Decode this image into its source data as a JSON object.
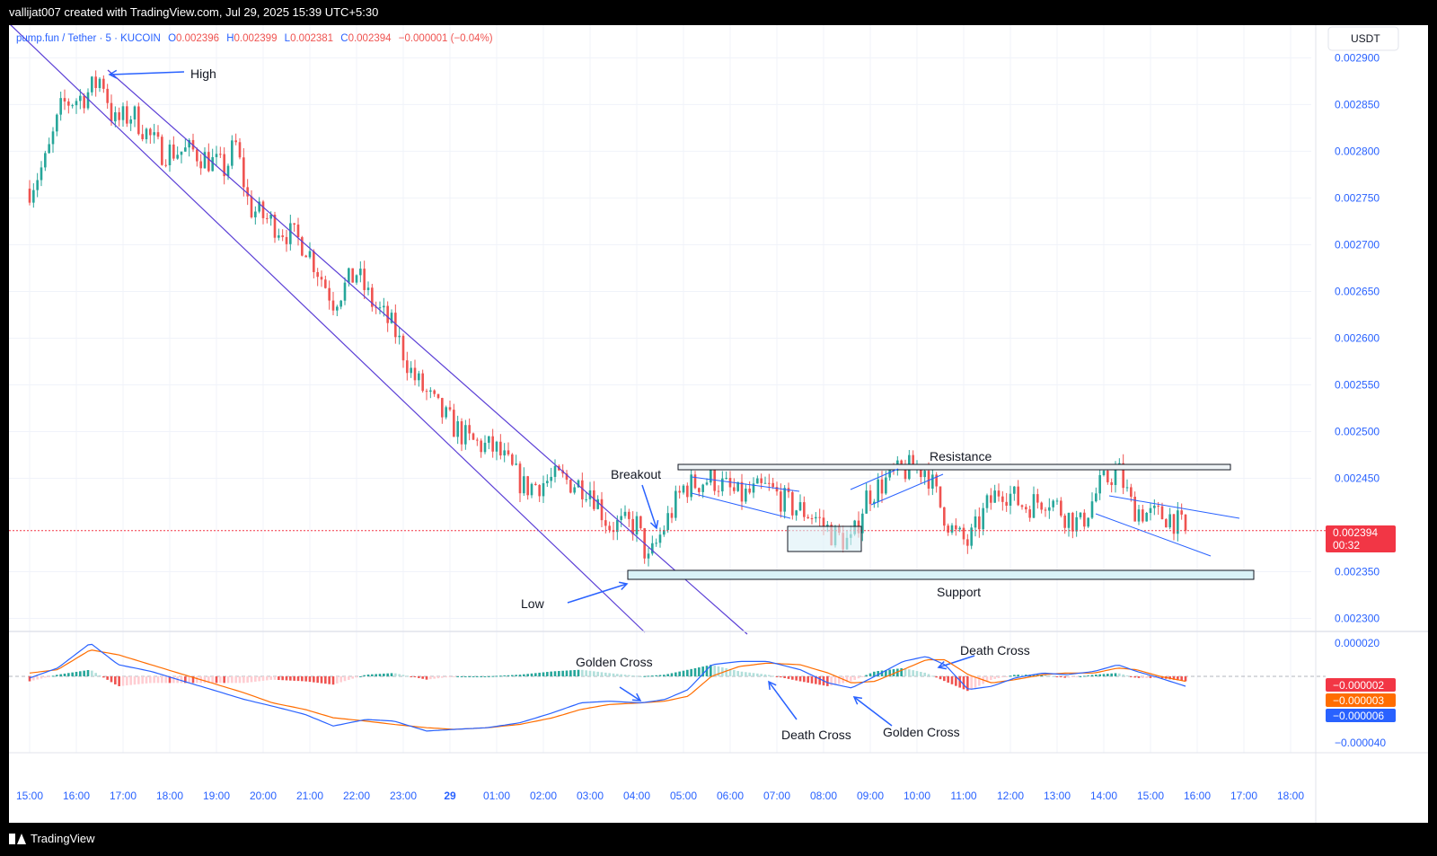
{
  "header": {
    "creator_line": "vallijat007 created with TradingView.com, Jul 29, 2025 15:39 UTC+5:30"
  },
  "footer": {
    "brand": "TradingView"
  },
  "legend": {
    "symbol": "pump.fun / Tether · 5 · KUCOIN",
    "o_label": "O",
    "o_value": "0.002396",
    "h_label": "H",
    "h_value": "0.002399",
    "l_label": "L",
    "l_value": "0.002381",
    "c_label": "C",
    "c_value": "0.002394",
    "change": "−0.000001 (−0.04%)"
  },
  "currency": "USDT",
  "colors": {
    "up": "#26a69a",
    "down": "#ef5350",
    "drawing": "#5b3fd6",
    "trend": "#2962ff",
    "macd_line": "#2962ff",
    "signal_line": "#ff6d00",
    "hist_up": "#26a69a",
    "hist_down": "#ef5350",
    "price_tag": "#f23645",
    "support_fill": "#d9f2f7",
    "label_blue": "#2962ff"
  },
  "price_tag": {
    "value": "0.002394",
    "countdown": "00:32"
  },
  "macd_tags": [
    "−0.000002",
    "−0.000003",
    "−0.000006"
  ],
  "annotations": {
    "high": "High",
    "low": "Low",
    "breakout": "Breakout",
    "resistance": "Resistance",
    "support": "Support",
    "golden_cross_1": "Golden Cross",
    "death_cross_1": "Death Cross",
    "golden_cross_2": "Golden Cross",
    "death_cross_2": "Death Cross"
  },
  "chart_data": {
    "type": "candlestick",
    "y_ticks": [
      "0.002900",
      "0.002850",
      "0.002800",
      "0.002750",
      "0.002700",
      "0.002650",
      "0.002600",
      "0.002550",
      "0.002500",
      "0.002450",
      "0.002350",
      "0.002300"
    ],
    "ylim": [
      0.002288,
      0.002935
    ],
    "x_ticks": [
      "15:00",
      "16:00",
      "17:00",
      "18:00",
      "19:00",
      "20:00",
      "21:00",
      "22:00",
      "23:00",
      "29",
      "01:00",
      "02:00",
      "03:00",
      "04:00",
      "05:00",
      "06:00",
      "07:00",
      "08:00",
      "09:00",
      "10:00",
      "11:00",
      "12:00",
      "13:00",
      "14:00",
      "15:00",
      "16:00",
      "17:00",
      "18:00"
    ],
    "close_path": [
      [
        0.0,
        0.00276
      ],
      [
        0.35,
        0.00279
      ],
      [
        0.7,
        0.00285
      ],
      [
        1.2,
        0.00286
      ],
      [
        1.55,
        0.00288
      ],
      [
        1.8,
        0.00283
      ],
      [
        2.2,
        0.00284
      ],
      [
        2.8,
        0.0028
      ],
      [
        3.5,
        0.0028
      ],
      [
        4.2,
        0.00278
      ],
      [
        4.4,
        0.00281
      ],
      [
        4.7,
        0.00274
      ],
      [
        5.3,
        0.00272
      ],
      [
        5.9,
        0.0027
      ],
      [
        6.5,
        0.00264
      ],
      [
        7.0,
        0.00267
      ],
      [
        7.3,
        0.00264
      ],
      [
        7.8,
        0.00261
      ],
      [
        8.2,
        0.00256
      ],
      [
        8.8,
        0.00252
      ],
      [
        9.4,
        0.00249
      ],
      [
        10.0,
        0.00248
      ],
      [
        10.6,
        0.00244
      ],
      [
        11.3,
        0.00245
      ],
      [
        12.0,
        0.00244
      ],
      [
        12.4,
        0.0024
      ],
      [
        13.0,
        0.0024
      ],
      [
        13.25,
        0.00236
      ],
      [
        13.6,
        0.0024
      ],
      [
        14.0,
        0.00244
      ],
      [
        14.6,
        0.00245
      ],
      [
        15.2,
        0.00243
      ],
      [
        15.8,
        0.00244
      ],
      [
        16.3,
        0.00242
      ],
      [
        16.8,
        0.00241
      ],
      [
        17.2,
        0.00239
      ],
      [
        17.6,
        0.00238
      ],
      [
        17.9,
        0.00243
      ],
      [
        18.4,
        0.00245
      ],
      [
        18.8,
        0.00246
      ],
      [
        19.2,
        0.00246
      ],
      [
        19.5,
        0.00242
      ],
      [
        19.8,
        0.00239
      ],
      [
        20.1,
        0.00238
      ],
      [
        20.5,
        0.00242
      ],
      [
        20.8,
        0.00244
      ],
      [
        21.3,
        0.00242
      ],
      [
        21.8,
        0.00243
      ],
      [
        22.2,
        0.00241
      ],
      [
        22.5,
        0.0024
      ],
      [
        22.9,
        0.00244
      ],
      [
        23.3,
        0.00246
      ],
      [
        23.6,
        0.00242
      ],
      [
        24.0,
        0.00241
      ],
      [
        24.4,
        0.00241
      ],
      [
        24.75,
        0.002394
      ]
    ],
    "indicator": {
      "name": "MACD",
      "y_ticks": [
        "0.000020",
        "−0.000040"
      ],
      "ylim": [
        -4.5e-05,
        2.6e-05
      ],
      "macd": [
        [
          0,
          -1e-06
        ],
        [
          0.6,
          5e-06
        ],
        [
          1.3,
          2e-05
        ],
        [
          1.9,
          7e-06
        ],
        [
          2.6,
          3e-06
        ],
        [
          3.3,
          -3e-06
        ],
        [
          3.9,
          -8e-06
        ],
        [
          4.6,
          -1.4e-05
        ],
        [
          5.2,
          -1.8e-05
        ],
        [
          5.9,
          -2.3e-05
        ],
        [
          6.5,
          -3e-05
        ],
        [
          7.2,
          -2.6e-05
        ],
        [
          7.8,
          -2.7e-05
        ],
        [
          8.5,
          -3.3e-05
        ],
        [
          9.1,
          -3.2e-05
        ],
        [
          9.8,
          -3.1e-05
        ],
        [
          10.5,
          -2.8e-05
        ],
        [
          11.2,
          -2.2e-05
        ],
        [
          11.8,
          -1.6e-05
        ],
        [
          12.4,
          -1.5e-05
        ],
        [
          13.1,
          -1.6e-05
        ],
        [
          13.6,
          -1.4e-05
        ],
        [
          14.1,
          -8e-06
        ],
        [
          14.6,
          7e-06
        ],
        [
          15.2,
          9e-06
        ],
        [
          15.8,
          9e-06
        ],
        [
          16.5,
          4e-06
        ],
        [
          17.1,
          -4e-06
        ],
        [
          17.6,
          -7e-06
        ],
        [
          18.1,
          0.0
        ],
        [
          18.7,
          9e-06
        ],
        [
          19.2,
          1.2e-05
        ],
        [
          19.6,
          7e-06
        ],
        [
          20.1,
          -8e-06
        ],
        [
          20.6,
          -6e-06
        ],
        [
          21.1,
          -1e-06
        ],
        [
          21.7,
          2e-06
        ],
        [
          22.2,
          1e-06
        ],
        [
          22.8,
          3e-06
        ],
        [
          23.3,
          7e-06
        ],
        [
          23.7,
          3e-06
        ],
        [
          24.2,
          -1e-06
        ],
        [
          24.75,
          -6e-06
        ]
      ],
      "signal": [
        [
          0,
          2e-06
        ],
        [
          0.6,
          4e-06
        ],
        [
          1.3,
          1.6e-05
        ],
        [
          1.9,
          1.3e-05
        ],
        [
          2.6,
          7e-06
        ],
        [
          3.3,
          1e-06
        ],
        [
          3.9,
          -4e-06
        ],
        [
          4.6,
          -1e-05
        ],
        [
          5.2,
          -1.6e-05
        ],
        [
          5.9,
          -2e-05
        ],
        [
          6.5,
          -2.5e-05
        ],
        [
          7.2,
          -2.7e-05
        ],
        [
          7.8,
          -2.9e-05
        ],
        [
          8.5,
          -3.1e-05
        ],
        [
          9.1,
          -3.2e-05
        ],
        [
          9.8,
          -3.1e-05
        ],
        [
          10.5,
          -2.9e-05
        ],
        [
          11.2,
          -2.5e-05
        ],
        [
          11.8,
          -2e-05
        ],
        [
          12.4,
          -1.7e-05
        ],
        [
          13.1,
          -1.6e-05
        ],
        [
          13.6,
          -1.5e-05
        ],
        [
          14.1,
          -1.2e-05
        ],
        [
          14.6,
          0.0
        ],
        [
          15.2,
          6e-06
        ],
        [
          15.8,
          8e-06
        ],
        [
          16.5,
          7e-06
        ],
        [
          17.1,
          2e-06
        ],
        [
          17.6,
          -4e-06
        ],
        [
          18.1,
          -3e-06
        ],
        [
          18.7,
          4e-06
        ],
        [
          19.2,
          1e-05
        ],
        [
          19.6,
          1e-05
        ],
        [
          20.1,
          1e-06
        ],
        [
          20.6,
          -4e-06
        ],
        [
          21.1,
          -2e-06
        ],
        [
          21.7,
          1e-06
        ],
        [
          22.2,
          2e-06
        ],
        [
          22.8,
          2e-06
        ],
        [
          23.3,
          5e-06
        ],
        [
          23.7,
          4e-06
        ],
        [
          24.2,
          0.0
        ],
        [
          24.75,
          -3e-06
        ]
      ]
    }
  }
}
